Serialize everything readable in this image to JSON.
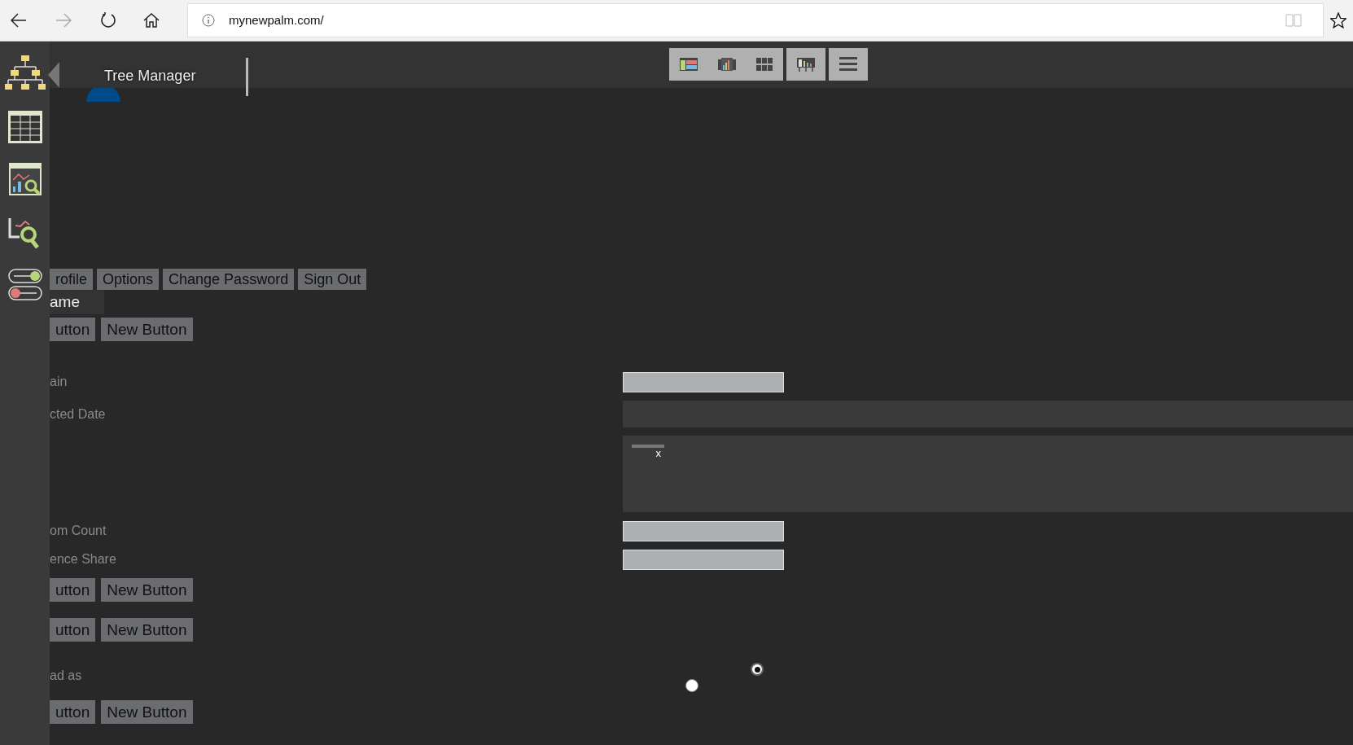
{
  "browser": {
    "url": "mynewpalm.com/"
  },
  "header": {
    "title": "Tree Manager"
  },
  "sidebar": {
    "items": [
      {
        "kind": "tree"
      },
      {
        "kind": "table"
      },
      {
        "kind": "chart"
      },
      {
        "kind": "search"
      },
      {
        "kind": "toggles"
      }
    ]
  },
  "toolbar": {
    "groups": [
      [
        {
          "kind": "layout"
        },
        {
          "kind": "chart"
        },
        {
          "kind": "grid"
        }
      ],
      [
        {
          "kind": "presentation"
        }
      ],
      [
        {
          "kind": "menu"
        }
      ]
    ]
  },
  "menu": [
    "rofile",
    "Options",
    "Change Password",
    "Sign Out"
  ],
  "name_label": "ame",
  "rows": [
    {
      "kind": "buttons",
      "buttons": [
        "utton",
        "New Button"
      ]
    },
    {
      "kind": "field",
      "label": "ain"
    },
    {
      "kind": "wide_field",
      "label": "cted Date"
    },
    {
      "kind": "tags",
      "tag": "x"
    },
    {
      "kind": "field",
      "label": "om Count"
    },
    {
      "kind": "field",
      "label": "ence Share"
    },
    {
      "kind": "buttons",
      "buttons": [
        "utton",
        "New Button"
      ]
    },
    {
      "kind": "buttons",
      "buttons": [
        "utton",
        "New Button"
      ]
    },
    {
      "kind": "radios",
      "label": "ad as",
      "options": [
        {
          "selected": false
        },
        {
          "selected": true
        }
      ]
    },
    {
      "kind": "buttons",
      "buttons": [
        "utton",
        "New Button"
      ]
    }
  ]
}
